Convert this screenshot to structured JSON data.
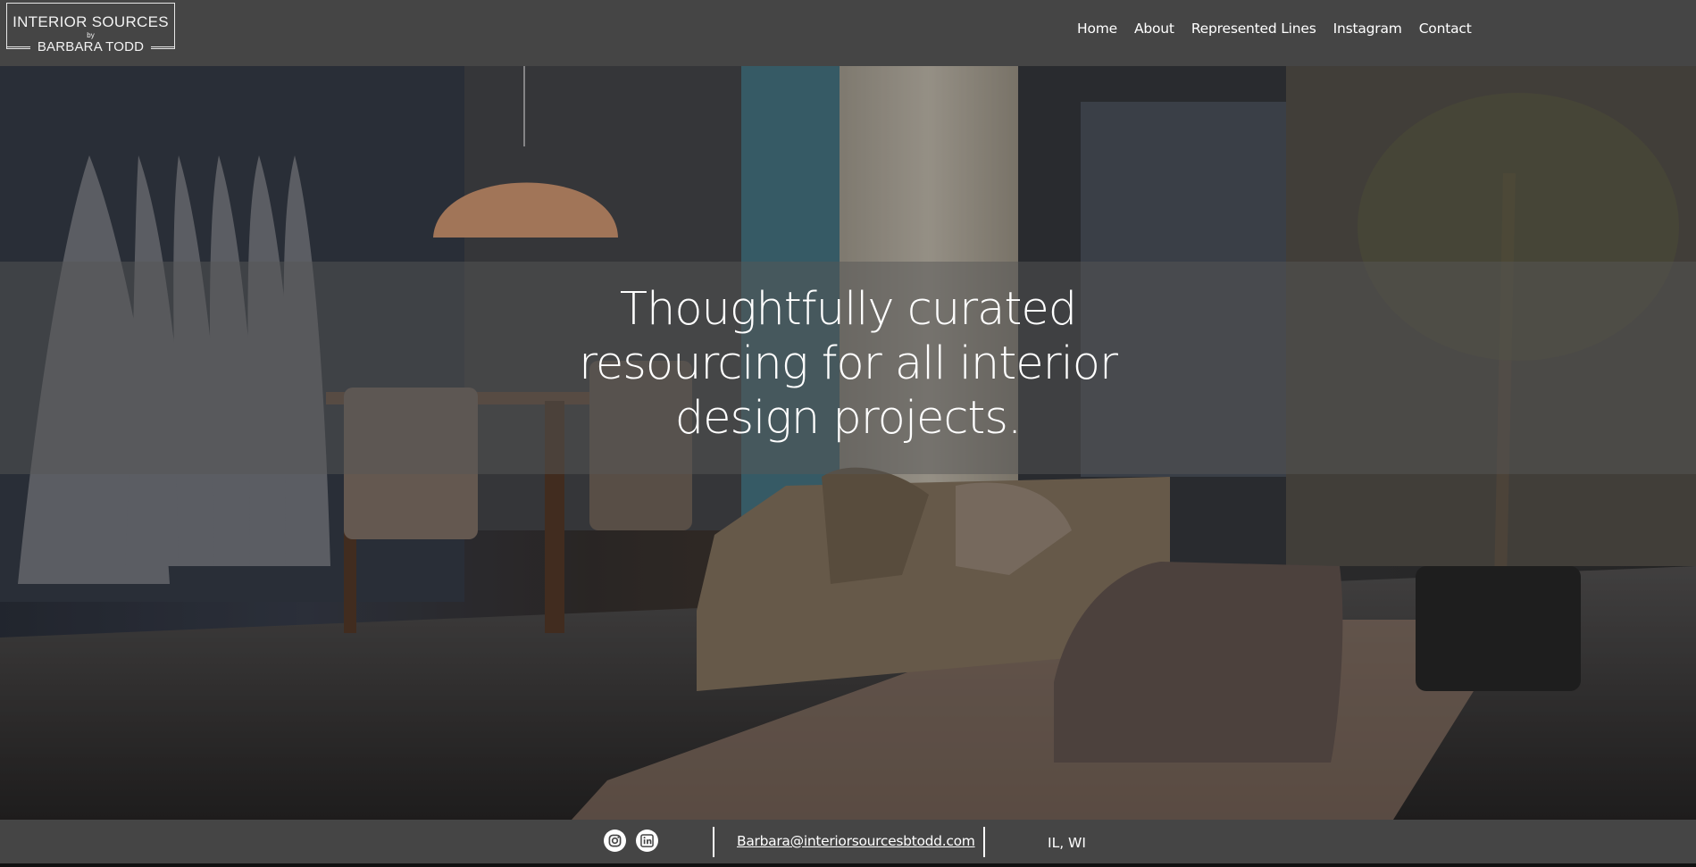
{
  "brand": {
    "line1": "INTERIOR SOURCES",
    "by": "by",
    "line2": "BARBARA TODD"
  },
  "nav": {
    "items": [
      {
        "label": "Home"
      },
      {
        "label": "About"
      },
      {
        "label": "Represented Lines"
      },
      {
        "label": "Instagram"
      },
      {
        "label": "Contact"
      }
    ]
  },
  "hero": {
    "headline_lines": [
      "Thoughtfully curated",
      "resourcing for all interior",
      "design projects."
    ]
  },
  "footer": {
    "social_icons": [
      "instagram-icon",
      "linkedin-icon"
    ],
    "email": "Barbara@interiorsourcesbtodd.com",
    "location": "IL, WI"
  },
  "colors": {
    "header_bg": "#454545",
    "footer_bg": "#454545",
    "text": "#ffffff"
  }
}
